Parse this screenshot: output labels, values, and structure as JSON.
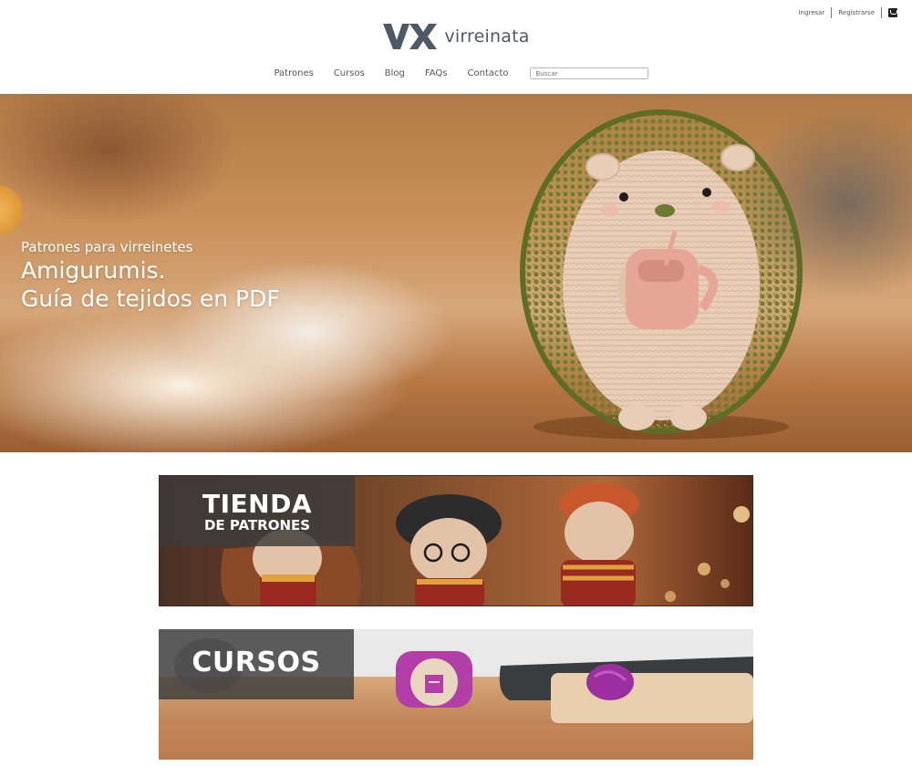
{
  "utility": {
    "login": "Ingresar",
    "register": "Registrarse",
    "cart_icon": "shopping-bag-icon"
  },
  "logo": {
    "mark": "VX",
    "name": "virreinata",
    "color": "#4d5a66"
  },
  "nav": {
    "items": [
      "Patrones",
      "Cursos",
      "Blog",
      "FAQs",
      "Contacto"
    ],
    "search_placeholder": "Buscar"
  },
  "hero": {
    "subtitle": "Patrones para virreinetes",
    "title_line1": "Amigurumis.",
    "title_line2": "Guía de tejidos en PDF"
  },
  "banners": {
    "shop": {
      "title": "TIENDA",
      "subtitle": "DE PATRONES"
    },
    "courses": {
      "title": "CURSOS"
    }
  },
  "colors": {
    "accent_green": "#7a8a3a",
    "accent_purple": "#b23fa8",
    "text": "#4a4a4a"
  }
}
